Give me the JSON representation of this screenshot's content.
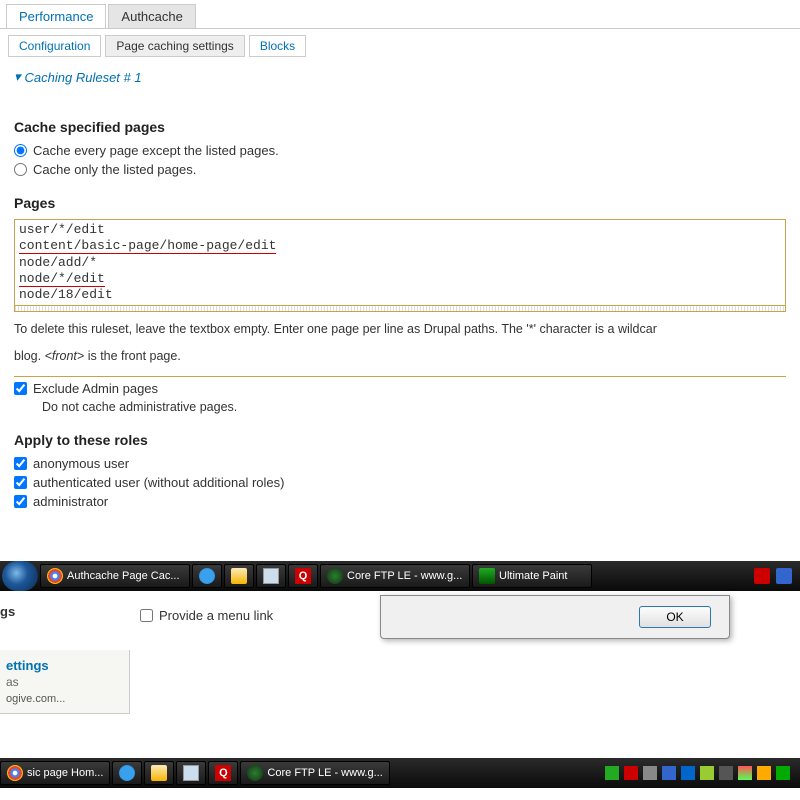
{
  "tabs": {
    "performance": "Performance",
    "authcache": "Authcache"
  },
  "subtabs": {
    "configuration": "Configuration",
    "page_caching": "Page caching settings",
    "blocks": "Blocks"
  },
  "legend": "Caching Ruleset # 1",
  "sections": {
    "cache_pages_title": "Cache specified pages",
    "radio_except": "Cache every page except the listed pages.",
    "radio_only": "Cache only the listed pages.",
    "pages_title": "Pages",
    "pages_lines": {
      "l1": "user/*/edit",
      "l2": "content/basic-page/home-page/edit",
      "l3": "node/add/*",
      "l4": "node/*/edit",
      "l5": "node/18/edit"
    },
    "help1": "To delete this ruleset, leave the textbox empty. Enter one page per line as Drupal paths. The '*' character is a wildcar",
    "help2_prefix": "blog. ",
    "help2_em": "<front>",
    "help2_suffix": " is the front page.",
    "exclude_admin": "Exclude Admin pages",
    "exclude_admin_desc": "Do not cache administrative pages.",
    "roles_title": "Apply to these roles",
    "roles": {
      "anon": "anonymous user",
      "auth": "authenticated user (without additional roles)",
      "admin": "administrator"
    }
  },
  "taskbar_upper": {
    "t1": "Authcache Page Cac...",
    "t2": "Core FTP LE - www.g...",
    "t3": "Ultimate Paint"
  },
  "dialog": {
    "ok": "OK"
  },
  "lower_left": {
    "gs": "gs",
    "menu_link": "Provide a menu link"
  },
  "settings_block": {
    "title": "ettings",
    "alias": "as",
    "url": "ogive.com..."
  },
  "taskbar_lower": {
    "t1": "sic page Hom...",
    "t2": "Core FTP LE - www.g..."
  }
}
